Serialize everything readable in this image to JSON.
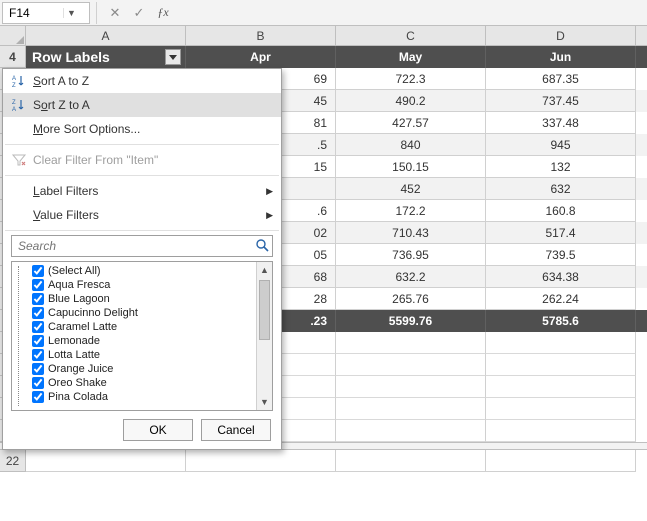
{
  "namebox": {
    "value": "F14"
  },
  "columns": [
    "A",
    "B",
    "C",
    "D"
  ],
  "header_row_number": "4",
  "row22": "22",
  "pivot": {
    "row_labels_header": "Row Labels",
    "col_headers": [
      "Apr",
      "May",
      "Jun"
    ],
    "rows": [
      {
        "partial_b": "69",
        "c": "722.3",
        "d": "687.35"
      },
      {
        "partial_b": "45",
        "c": "490.2",
        "d": "737.45"
      },
      {
        "partial_b": "81",
        "c": "427.57",
        "d": "337.48"
      },
      {
        "partial_b": ".5",
        "c": "840",
        "d": "945"
      },
      {
        "partial_b": "15",
        "c": "150.15",
        "d": "132"
      },
      {
        "partial_b": "",
        "c": "452",
        "d": "632"
      },
      {
        "partial_b": ".6",
        "c": "172.2",
        "d": "160.8"
      },
      {
        "partial_b": "02",
        "c": "710.43",
        "d": "517.4"
      },
      {
        "partial_b": "05",
        "c": "736.95",
        "d": "739.5"
      },
      {
        "partial_b": "68",
        "c": "632.2",
        "d": "634.38"
      },
      {
        "partial_b": "28",
        "c": "265.76",
        "d": "262.24"
      }
    ],
    "total": {
      "partial_b": ".23",
      "c": "5599.76",
      "d": "5785.6"
    }
  },
  "menu": {
    "sort_az": "Sort A to Z",
    "sort_za": "Sort Z to A",
    "more_sort": "More Sort Options...",
    "clear_filter": "Clear Filter From \"Item\"",
    "label_filters": "Label Filters",
    "value_filters": "Value Filters",
    "search_placeholder": "Search",
    "items": [
      "(Select All)",
      "Aqua Fresca",
      "Blue Lagoon",
      "Capucinno Delight",
      "Caramel Latte",
      "Lemonade",
      "Lotta Latte",
      "Orange Juice",
      "Oreo Shake",
      "Pina Colada"
    ],
    "ok": "OK",
    "cancel": "Cancel"
  }
}
